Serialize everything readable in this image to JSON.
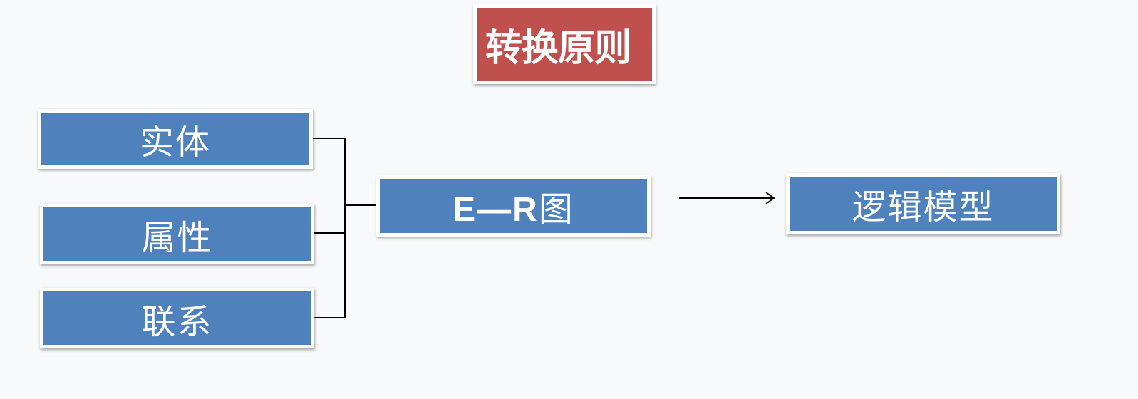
{
  "title": "转换原则",
  "inputs": [
    {
      "label": "实体"
    },
    {
      "label": "属性"
    },
    {
      "label": "联系"
    }
  ],
  "er_diagram": {
    "latin": "E—R",
    "cjk": "图"
  },
  "output": {
    "label": "逻辑模型"
  },
  "colors": {
    "title_fill": "#c0504d",
    "box_fill": "#4f81bd",
    "box_border": "#ffffff",
    "text": "#ffffff",
    "connector": "#000000",
    "background": "#f8f9fb"
  }
}
